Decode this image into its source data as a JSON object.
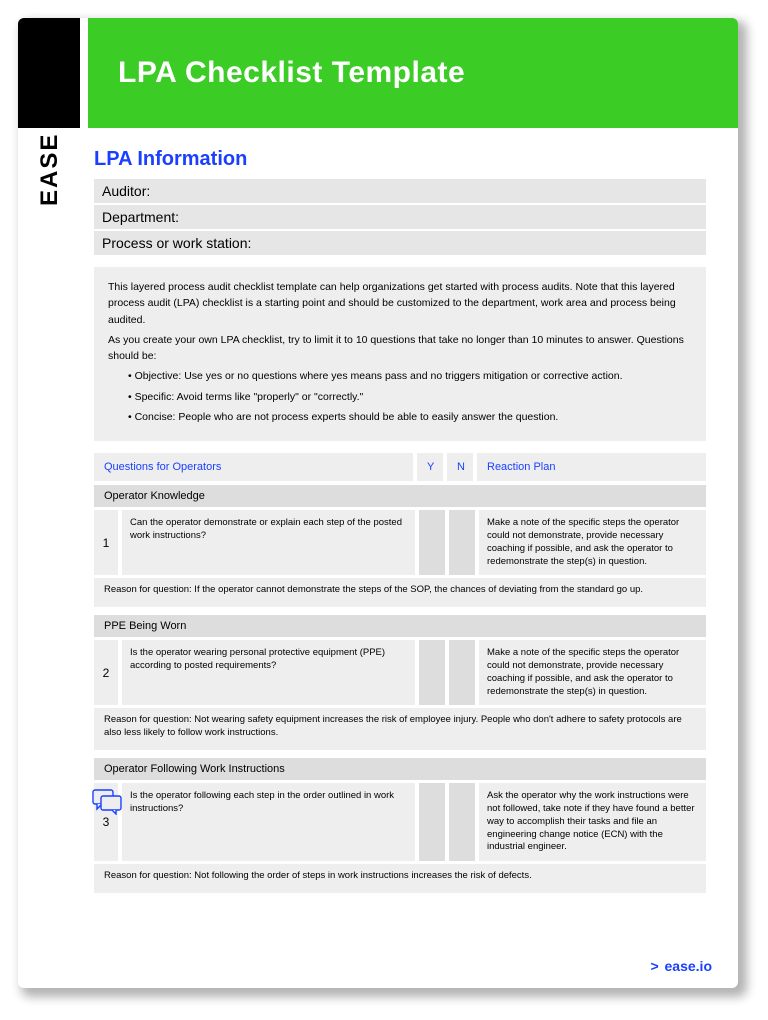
{
  "header": {
    "title": "LPA Checklist Template"
  },
  "logo_text": "EASE",
  "section_title": "LPA Information",
  "info_rows": {
    "auditor": "Auditor:",
    "department": "Department:",
    "process": "Process or work station:"
  },
  "intro": {
    "p1": "This layered process audit checklist template can help organizations get started with process audits. Note that this layered process audit (LPA) checklist is a starting point and should be customized to the department, work area and process being audited.",
    "p2": "As you create your own LPA checklist, try to limit it to 10 questions that take no longer than 10 minutes to answer. Questions should be:",
    "b1": "• Objective: Use yes or no questions where yes means pass and no triggers mitigation or corrective action.",
    "b2": "• Specific: Avoid terms like \"properly\" or \"correctly.\"",
    "b3": "• Concise: People who are not process experts should be able to easily answer the question."
  },
  "table_headers": {
    "questions": "Questions for Operators",
    "y": "Y",
    "n": "N",
    "reaction": "Reaction Plan"
  },
  "groups": [
    {
      "title": "Operator Knowledge",
      "num": "1",
      "question": "Can the operator demonstrate or explain each step of the posted work instructions?",
      "reaction": "Make a note of the specific steps the operator could not demonstrate, provide necessary coaching if possible, and ask the operator to redemonstrate the step(s) in question.",
      "reason": "Reason for question: If the operator cannot demonstrate the steps of the SOP, the chances of deviating from the standard go up."
    },
    {
      "title": "PPE Being Worn",
      "num": "2",
      "question": "Is the operator wearing personal protective equipment (PPE) according to posted requirements?",
      "reaction": "Make a note of the specific steps the operator could not demonstrate, provide necessary coaching if possible, and ask the operator to redemonstrate the step(s) in question.",
      "reason": "Reason for question: Not wearing safety equipment increases the risk of employee injury. People who don't adhere to safety protocols are also less likely to follow work instructions."
    },
    {
      "title": "Operator Following Work Instructions",
      "num": "3",
      "question": "Is the operator following each step in the order outlined in work instructions?",
      "reaction": "Ask the operator why the work instructions were not followed, take note if they have found a better way to accomplish their tasks and file an engineering change notice (ECN) with the industrial engineer.",
      "reason": "Reason for question: Not following the order of steps in work instructions increases the risk of defects."
    }
  ],
  "footer": {
    "gt": ">",
    "site": "ease.io"
  }
}
